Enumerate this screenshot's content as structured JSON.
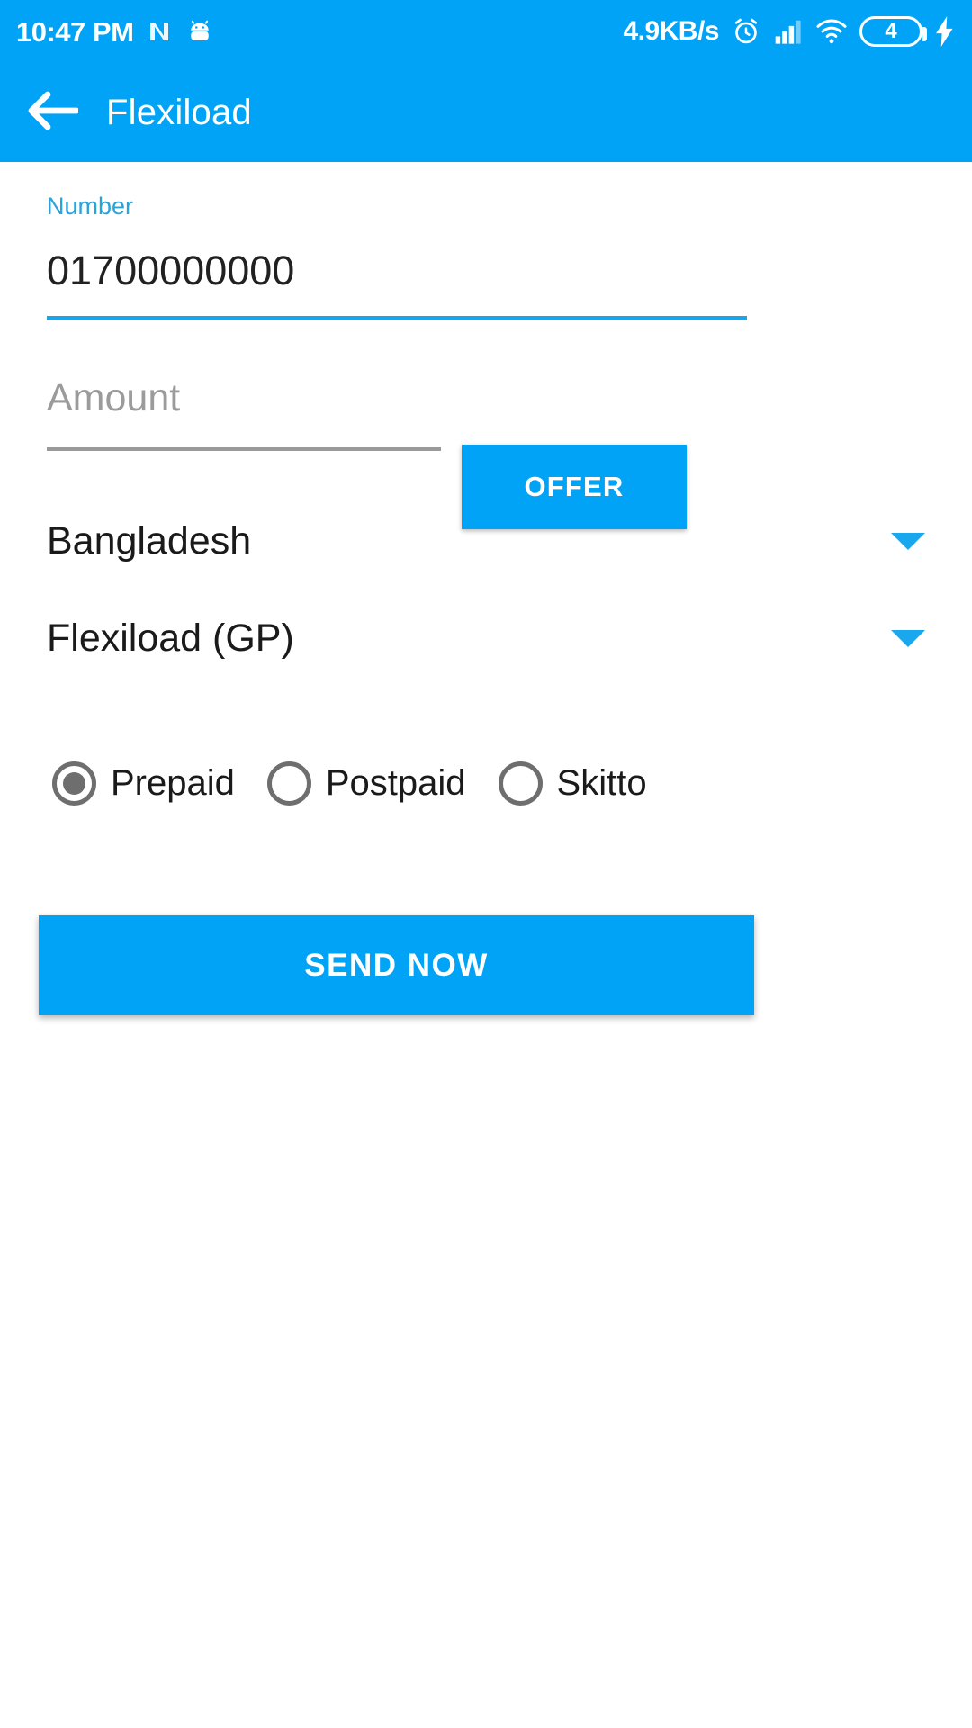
{
  "status_bar": {
    "time": "10:47 PM",
    "network_speed": "4.9KB/s",
    "battery_level": "4",
    "icons": [
      "nfc-icon",
      "android-robot-icon",
      "alarm-icon",
      "signal-icon",
      "wifi-icon",
      "battery-icon",
      "charging-bolt-icon"
    ],
    "background_color": "#00A3F5",
    "foreground_color": "#FFFFFF"
  },
  "app_bar": {
    "title": "Flexiload",
    "back_icon": "arrow-left-icon",
    "background_color": "#00A3F5"
  },
  "form": {
    "number_field": {
      "label": "Number",
      "value": "01700000000",
      "label_color": "#29A3DC",
      "underline_color": "#1CA4EA"
    },
    "amount_field": {
      "placeholder": "Amount",
      "value": "",
      "underline_color": "#9A9A9A"
    },
    "offer_button": {
      "label": "OFFER",
      "background_color": "#00A3F5"
    },
    "country_spinner": {
      "value": "Bangladesh",
      "caret_icon": "chevron-down-icon",
      "caret_color": "#19A7EE"
    },
    "operator_spinner": {
      "value": "Flexiload (GP)",
      "caret_icon": "chevron-down-icon",
      "caret_color": "#19A7EE"
    },
    "connection_type": {
      "options": [
        {
          "label": "Prepaid",
          "selected": true
        },
        {
          "label": "Postpaid",
          "selected": false
        },
        {
          "label": "Skitto",
          "selected": false
        }
      ],
      "radio_color": "#6E6E6E"
    },
    "send_button": {
      "label": "SEND NOW",
      "background_color": "#00A3F5"
    }
  }
}
